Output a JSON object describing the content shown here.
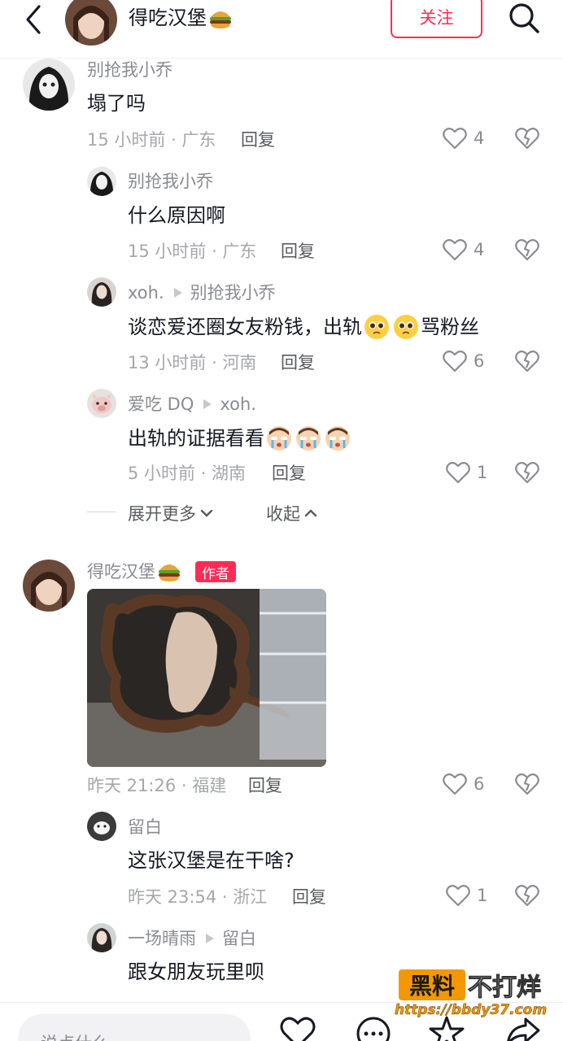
{
  "header": {
    "title": "得吃汉堡",
    "follow_label": "关注"
  },
  "comments": [
    {
      "user": "别抢我小乔",
      "text": "塌了吗",
      "meta": "15 小时前 · 广东",
      "reply_label": "回复",
      "likes": "4"
    },
    {
      "user": "别抢我小乔",
      "text": "什么原因啊",
      "meta": "15 小时前 · 广东",
      "reply_label": "回复",
      "likes": "4"
    },
    {
      "user": "xoh.",
      "reply_to": "别抢我小乔",
      "text_before": "谈恋爱还圈女友粉钱，出轨",
      "text_after": "骂粉丝",
      "meta": "13 小时前 · 河南",
      "reply_label": "回复",
      "likes": "6"
    },
    {
      "user": "爱吃 DQ",
      "reply_to": "xoh.",
      "text": "出轨的证据看看",
      "meta": "5 小时前 · 湖南",
      "reply_label": "回复",
      "likes": "1"
    },
    {
      "user": "得吃汉堡",
      "author_tag": "作者",
      "meta": "昨天 21:26 · 福建",
      "reply_label": "回复",
      "likes": "6"
    },
    {
      "user": "留白",
      "text": "这张汉堡是在干啥?",
      "meta": "昨天 23:54 · 浙江",
      "reply_label": "回复",
      "likes": "1"
    },
    {
      "user": "一场晴雨",
      "reply_to": "留白",
      "text": "跟女朋友玩里呗"
    }
  ],
  "thread_controls": {
    "expand_more": "展开更多",
    "collapse": "收起"
  },
  "bottom": {
    "input_placeholder": "说点什么"
  },
  "watermark": {
    "box": "黑料",
    "text": "不打烊",
    "url": "https://bbdy37.com"
  },
  "colors": {
    "accent": "#fe2c55",
    "meta_text": "#a6a7ab",
    "name_text": "#8a8b91"
  }
}
